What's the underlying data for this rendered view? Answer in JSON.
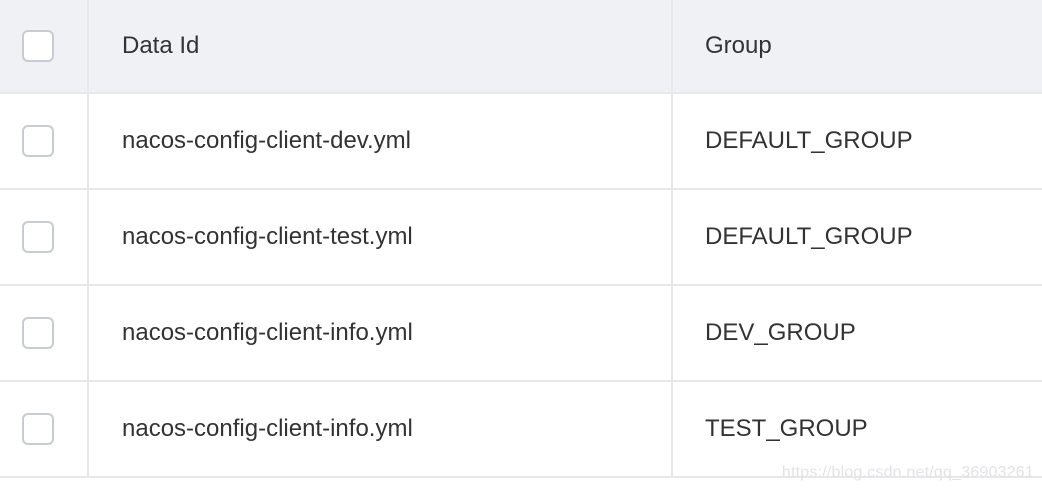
{
  "table": {
    "columns": {
      "data_id": "Data Id",
      "group": "Group"
    },
    "rows": [
      {
        "data_id": "nacos-config-client-dev.yml",
        "group": "DEFAULT_GROUP",
        "selected": false
      },
      {
        "data_id": "nacos-config-client-test.yml",
        "group": "DEFAULT_GROUP",
        "selected": false
      },
      {
        "data_id": "nacos-config-client-info.yml",
        "group": "DEV_GROUP",
        "selected": false
      },
      {
        "data_id": "nacos-config-client-info.yml",
        "group": "TEST_GROUP",
        "selected": false
      }
    ]
  },
  "watermark": "https://blog.csdn.net/qq_36903261",
  "colors": {
    "header_bg": "#eff1f5",
    "border": "#e6e8ec",
    "text": "#333333",
    "checkbox_border": "#c8cbd2"
  }
}
